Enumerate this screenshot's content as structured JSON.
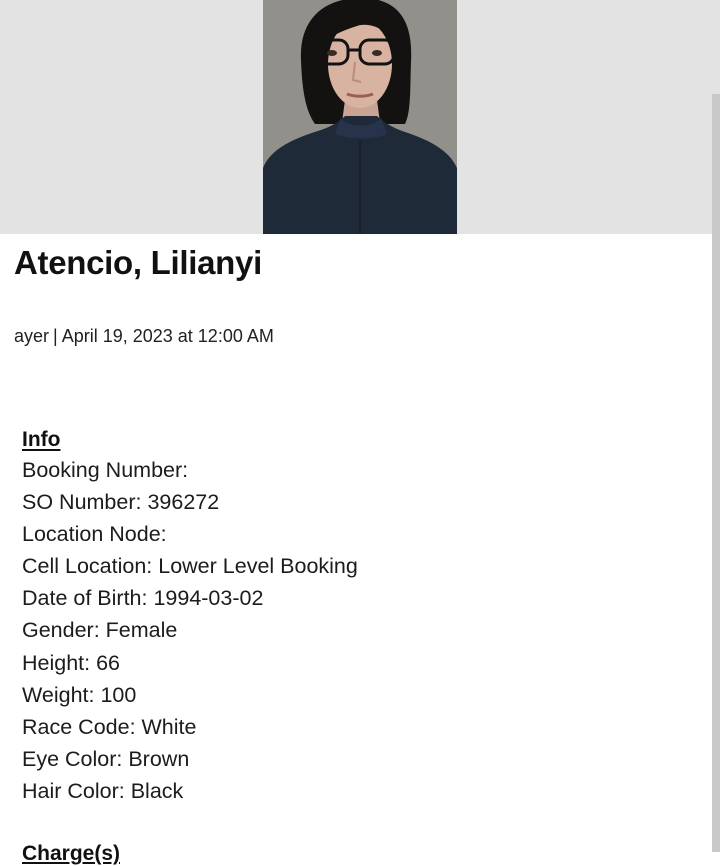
{
  "record": {
    "name": "Atencio, Lilianyi",
    "byline": {
      "author": "ayer",
      "separator": "|",
      "date": "April 19, 2023 at 12:00 AM"
    }
  },
  "info": {
    "heading": "Info",
    "fields": [
      "Booking Number:",
      "SO Number: 396272",
      "Location Node:",
      "Cell Location: Lower Level Booking",
      "Date of Birth: 1994-03-02",
      "Gender: Female",
      "Height: 66",
      "Weight: 100",
      "Race Code: White",
      "Eye Color: Brown",
      "Hair Color: Black"
    ]
  },
  "next_section": {
    "heading": "Charge(s)"
  },
  "colors": {
    "photo_band": "#e3e3e3",
    "photo_background": "#8d8c87",
    "jacket": "#1f2a38",
    "hair": "#141210",
    "text": "#1a1a1a"
  }
}
